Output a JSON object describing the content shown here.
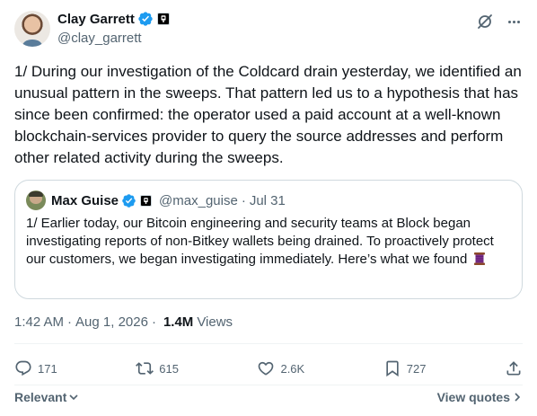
{
  "author": {
    "display_name": "Clay Garrett",
    "handle": "@clay_garrett"
  },
  "tweet": {
    "text": "1/ During our investigation of the Coldcard drain yesterday, we identified an unusual pattern in the sweeps. That pattern led us to a hypothesis that has since been confirmed: the operator used a paid account at a well-known blockchain-services provider to query the source addresses and perform other related activity during the sweeps.",
    "time": "1:42 AM",
    "separator": "·",
    "date": "Aug 1, 2026",
    "views_count": "1.4M",
    "views_label": "Views"
  },
  "quoted": {
    "display_name": "Max Guise",
    "handle": "@max_guise",
    "separator": "·",
    "date": "Jul 31",
    "text": "1/ Earlier today, our Bitcoin engineering and security teams at Block began investigating reports of non-Bitkey wallets being drained. To proactively protect our customers, we began investigating immediately. Here’s what we found"
  },
  "actions": {
    "replies": "171",
    "reposts": "615",
    "likes": "2.6K",
    "bookmarks": "727"
  },
  "footer": {
    "sort_label": "Relevant",
    "view_quotes_label": "View quotes"
  },
  "icons": {
    "verified": "verified-badge-icon",
    "affiliation": "affiliation-badge-icon",
    "grok": "grok-icon",
    "more": "more-icon",
    "reply": "reply-icon",
    "repost": "repost-icon",
    "like": "like-icon",
    "bookmark": "bookmark-icon",
    "share": "share-icon",
    "thread": "thread-spool-icon"
  },
  "colors": {
    "verified_blue": "#1d9bf0",
    "secondary_text": "#536471",
    "primary_text": "#0f1419"
  }
}
